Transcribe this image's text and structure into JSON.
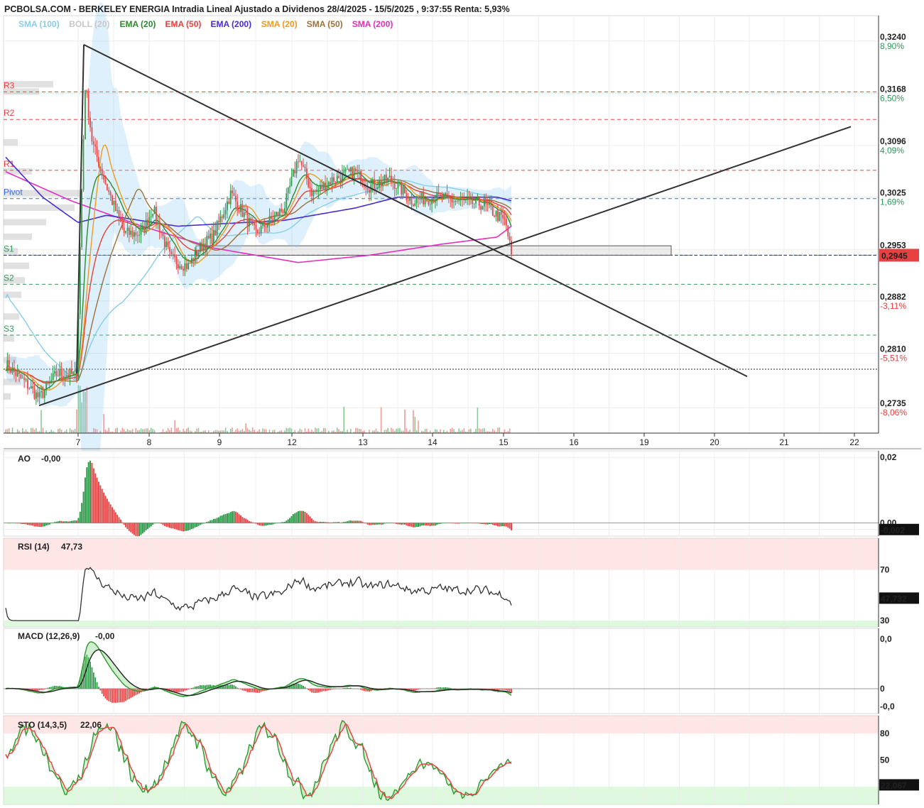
{
  "chart_data": [
    {
      "type": "candlestick",
      "title": "PCBOLSA.COM - BERKELEY ENERGIA Intradia Lineal Ajustado a Dividenos 28/4/2025 - 15/5/2025 , 9:37:55 Renta: 5,93%",
      "legend": [
        {
          "label": "SMA (100)",
          "color": "#87ceeb"
        },
        {
          "label": "BOLL (20)",
          "color": "#c8c8c8"
        },
        {
          "label": "EMA (20)",
          "color": "#2e8b2e"
        },
        {
          "label": "EMA (50)",
          "color": "#e8403a"
        },
        {
          "label": "EMA (200)",
          "color": "#4b2bd0"
        },
        {
          "label": "SMA (20)",
          "color": "#f09a20"
        },
        {
          "label": "SMA (50)",
          "color": "#a0703a"
        },
        {
          "label": "SMA (200)",
          "color": "#e030c0"
        }
      ],
      "x_ticks": [
        "7",
        "8",
        "9",
        "12",
        "13",
        "14",
        "15",
        "16",
        "19",
        "20",
        "21",
        "22"
      ],
      "ylim": [
        0.27,
        0.3275
      ],
      "y_ticks": [
        {
          "value": 0.324,
          "label": "0,3240",
          "pct": "8,90%",
          "pct_color": "#2e9a5a"
        },
        {
          "value": 0.3168,
          "label": "0,3168",
          "pct": "6,50%",
          "pct_color": "#2e9a5a"
        },
        {
          "value": 0.3096,
          "label": "0,3096",
          "pct": "4,09%",
          "pct_color": "#2e9a5a"
        },
        {
          "value": 0.3025,
          "label": "0,3025",
          "pct": "1,69%",
          "pct_color": "#2e9a5a"
        },
        {
          "value": 0.2953,
          "label": "0,2953",
          "pct": "",
          "pct_color": "#2e9a5a"
        },
        {
          "value": 0.2882,
          "label": "0,2882",
          "pct": "-3,11%",
          "pct_color": "#e84040"
        },
        {
          "value": 0.281,
          "label": "0,2810",
          "pct": "-5,51%",
          "pct_color": "#e84040"
        },
        {
          "value": 0.2735,
          "label": "0,2735",
          "pct": "-8,06%",
          "pct_color": "#e84040"
        }
      ],
      "last_price": {
        "value": 0.2945,
        "label": "0,2945",
        "color": "#e84040"
      },
      "reference_price": 0.2788,
      "pivots": [
        {
          "label": "R3",
          "value": 0.317,
          "color": "#e84040"
        },
        {
          "label": "R2",
          "value": 0.3132,
          "color": "#e84040"
        },
        {
          "label": "R1",
          "value": 0.3062,
          "color": "#e84040"
        },
        {
          "label": "Pivot",
          "value": 0.3023,
          "color": "#3a6fd8"
        },
        {
          "label": "S1",
          "value": 0.2945,
          "color": "#2e9a5a"
        },
        {
          "label": "S2",
          "value": 0.2905,
          "color": "#2e9a5a"
        },
        {
          "label": "S3",
          "value": 0.2835,
          "color": "#2e9a5a"
        }
      ]
    },
    {
      "type": "bar",
      "title": "AO",
      "current_label": "-0,00",
      "ylim": [
        -0.004,
        0.022
      ],
      "y_ticks": [
        {
          "value": 0.02,
          "label": "0,02"
        },
        {
          "value": 0.0,
          "label": "0,00"
        },
        {
          "value": -0.002,
          "label": "-0,00"
        }
      ],
      "last_value": {
        "value": -0.002,
        "label": "-0,002"
      }
    },
    {
      "type": "line",
      "title": "RSI (14)",
      "current_label": "47,73",
      "ylim": [
        25,
        95
      ],
      "y_ticks": [
        {
          "value": 70,
          "label": "70"
        },
        {
          "value": 30,
          "label": "30"
        }
      ],
      "last_value": {
        "value": 47.732,
        "label": "47,732"
      }
    },
    {
      "type": "line",
      "title": "MACD (12,26,9)",
      "current_label": "-0,00",
      "ylim": [
        -0.0035,
        0.0085
      ],
      "y_ticks": [
        {
          "value": 0.007,
          "label": "0,0",
          "color": "#e84040"
        },
        {
          "value": 0.0,
          "label": "0",
          "color": "#222"
        },
        {
          "value": -0.0025,
          "label": "-0,0",
          "color": "#2e9a5a"
        }
      ]
    },
    {
      "type": "line",
      "title": "STO (14,3,5)",
      "current_label": "22,06",
      "ylim": [
        0,
        100
      ],
      "y_ticks": [
        {
          "value": 80,
          "label": "80",
          "color": "#e84040"
        },
        {
          "value": 50,
          "label": "50",
          "color": "#222"
        }
      ],
      "last_value": {
        "value": 22.067,
        "label": "22,067"
      }
    }
  ]
}
